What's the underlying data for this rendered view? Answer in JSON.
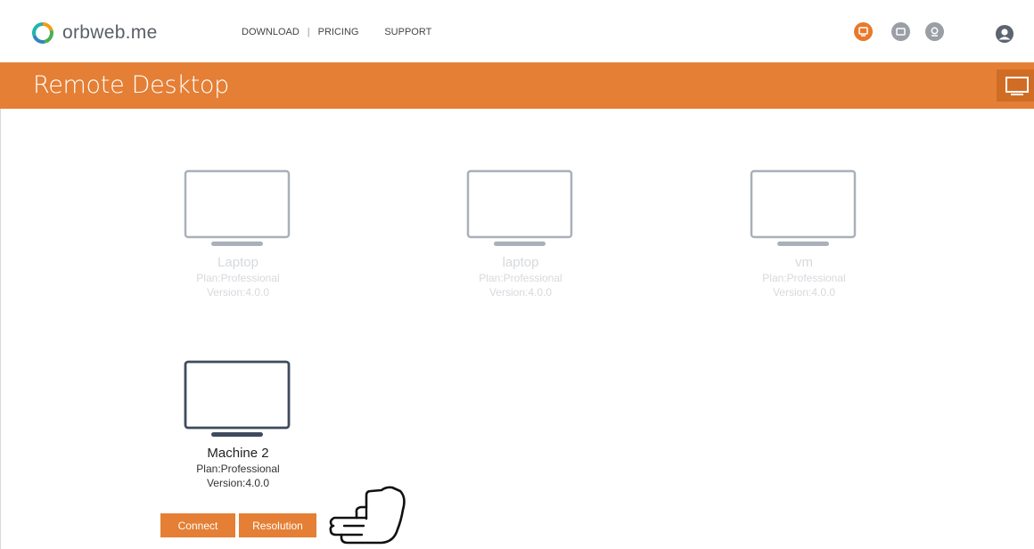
{
  "brand": {
    "name": "orbweb.me",
    "logo_icon": "orbweb-ring-logo"
  },
  "nav": {
    "links": [
      {
        "label": "DOWNLOAD"
      },
      {
        "label": "PRICING"
      },
      {
        "label": "SUPPORT"
      }
    ],
    "separator": "|",
    "icons": [
      "remote-desktop-icon",
      "files-icon",
      "webcam-icon",
      "user-account-icon"
    ]
  },
  "header": {
    "title": "Remote Desktop",
    "action_icon": "fullscreen-icon"
  },
  "machines": [
    {
      "name": "Laptop",
      "plan": "Plan:Professional",
      "version": "Version:4.0.0",
      "status": "offline"
    },
    {
      "name": "laptop",
      "plan": "Plan:Professional",
      "version": "Version:4.0.0",
      "status": "offline"
    },
    {
      "name": "vm",
      "plan": "Plan:Professional",
      "version": "Version:4.0.0",
      "status": "offline"
    },
    {
      "name": "Machine 2",
      "plan": "Plan:Professional",
      "version": "Version:4.0.0",
      "status": "online"
    }
  ],
  "actions": {
    "connect": "Connect",
    "resolution": "Resolution"
  },
  "colors": {
    "accent": "#e47f35",
    "offline_monitor": "#a9b0ba",
    "online_monitor": "#3e4b5d"
  }
}
